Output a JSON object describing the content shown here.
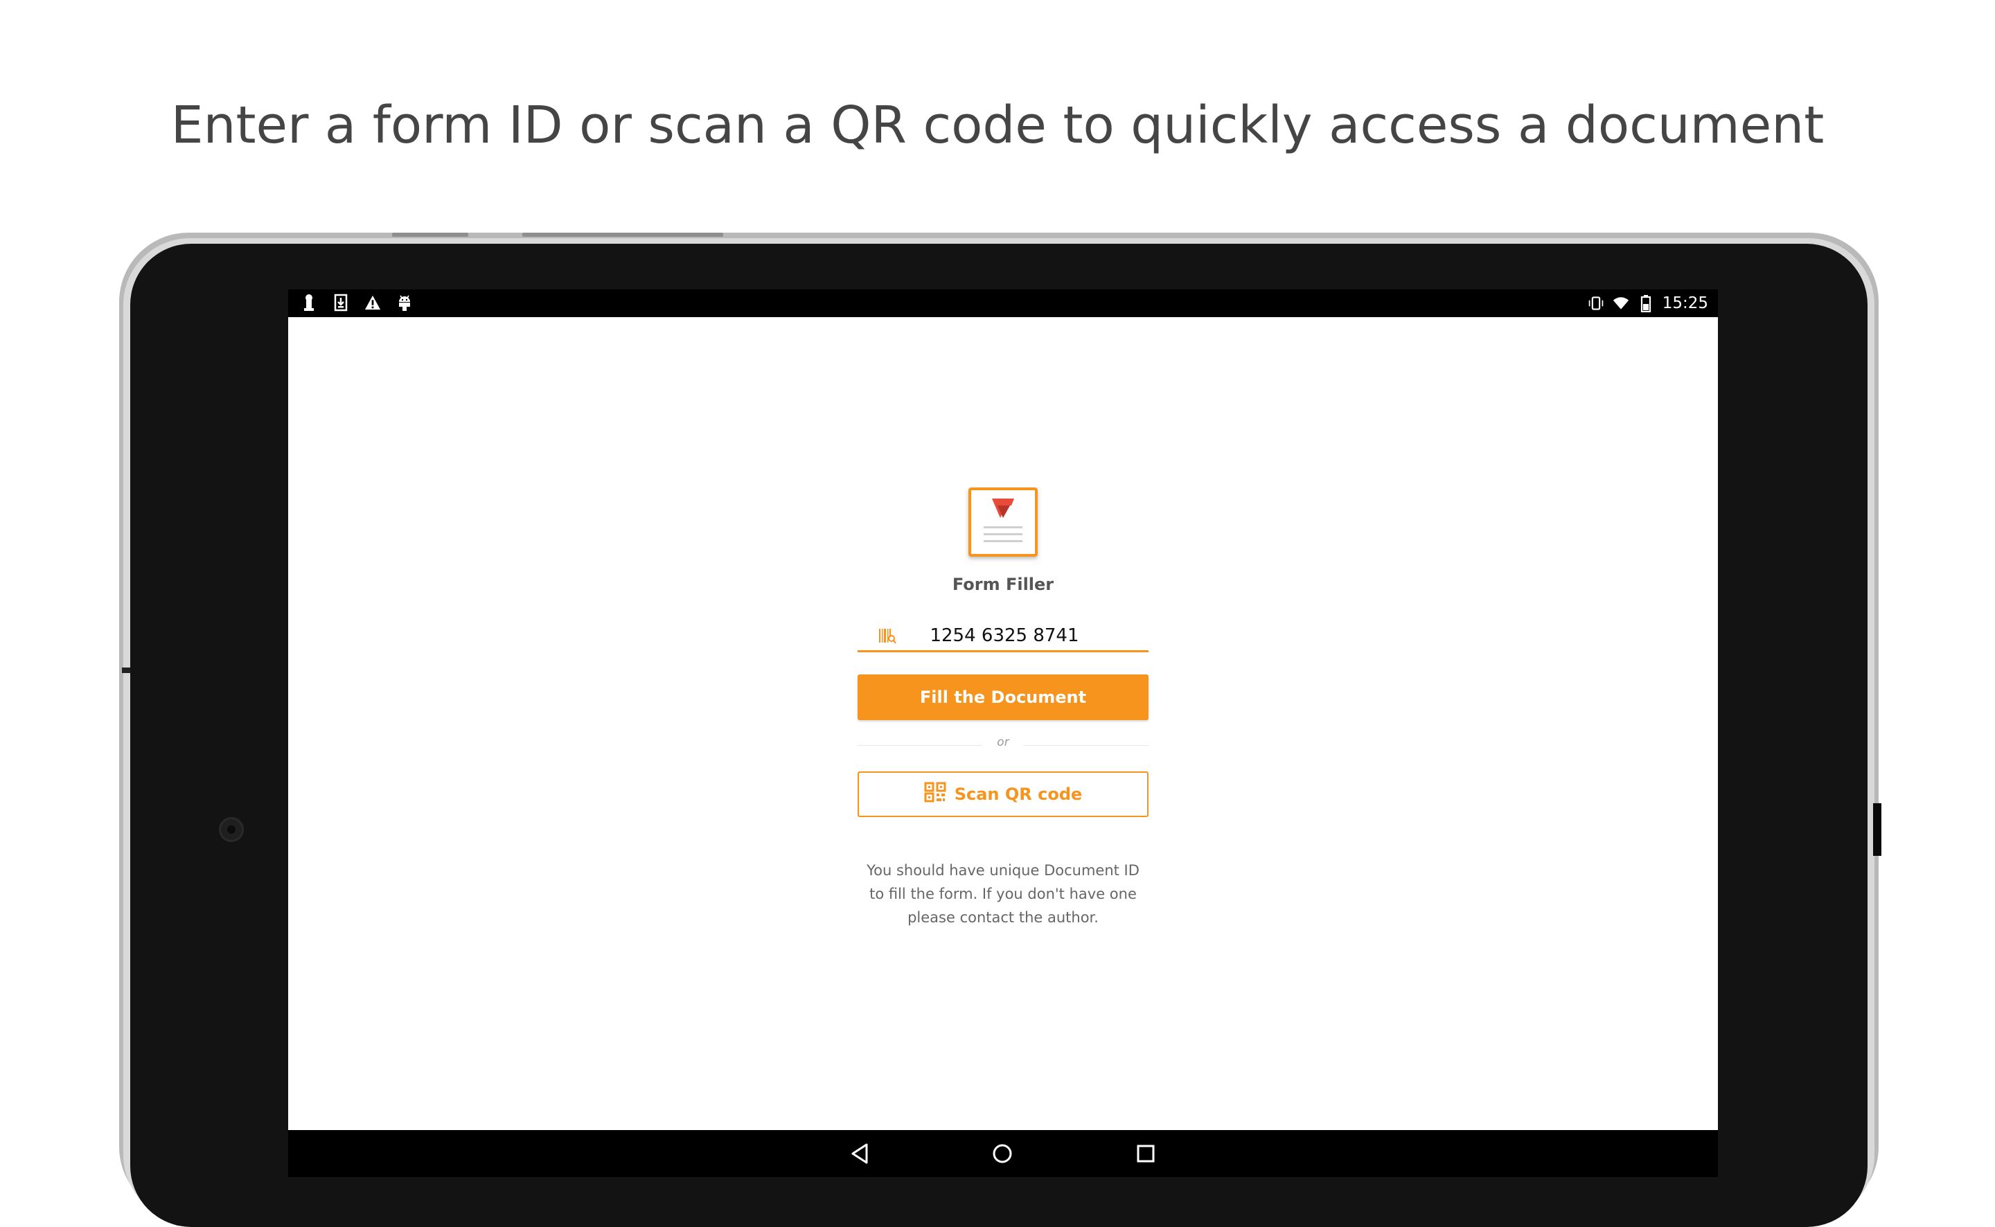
{
  "caption": "Enter a form ID or scan a QR code to quickly access a document",
  "status_bar": {
    "left_icons": [
      "keyhole-icon",
      "download-icon",
      "warning-icon",
      "android-icon"
    ],
    "right_icons": [
      "vibrate-icon",
      "wifi-icon",
      "battery-icon"
    ],
    "time": "15:25"
  },
  "app": {
    "name": "Form Filler",
    "document_id": {
      "value": "1254 6325 8741",
      "icon": "barcode-icon"
    },
    "fill_button_label": "Fill the Document",
    "or_label": "or",
    "scan_button": {
      "label": "Scan QR code",
      "icon": "qr-code-icon"
    },
    "hint": "You should have unique Document ID to fill the form. If you don't have one please contact the author."
  },
  "nav_bar": {
    "buttons": [
      "back-icon",
      "home-icon",
      "recents-icon"
    ]
  },
  "colors": {
    "accent": "#f7941d",
    "logo_red": "#e84b3a",
    "text": "#454545"
  }
}
